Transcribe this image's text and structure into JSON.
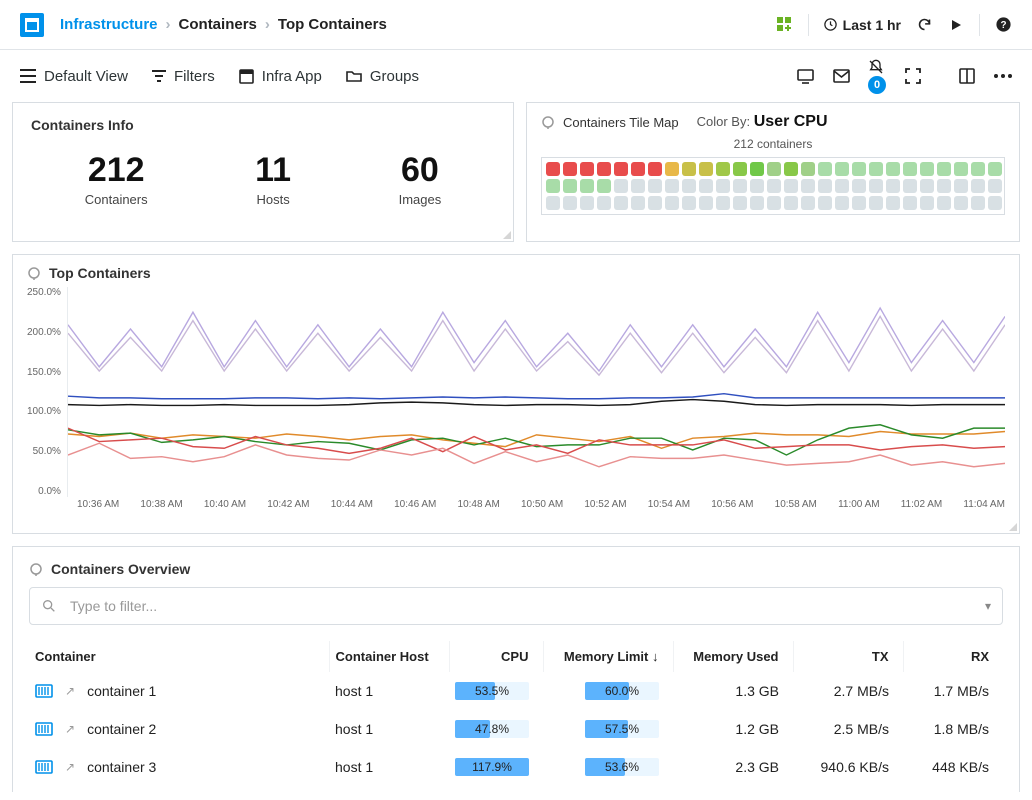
{
  "breadcrumbs": {
    "root": "Infrastructure",
    "mid": "Containers",
    "leaf": "Top Containers"
  },
  "topbar": {
    "timerange": "Last 1 hr"
  },
  "toolbar": {
    "default_view": "Default View",
    "filters": "Filters",
    "infra_app": "Infra App",
    "groups": "Groups",
    "badge": "0"
  },
  "info": {
    "title": "Containers Info",
    "containers_n": "212",
    "containers_l": "Containers",
    "hosts_n": "11",
    "hosts_l": "Hosts",
    "images_n": "60",
    "images_l": "Images"
  },
  "tilemap": {
    "title": "Containers Tile Map",
    "colorby_label": "Color By:",
    "colorby_value": "User CPU",
    "subtitle": "212 containers"
  },
  "chart_panel_title": "Top Containers",
  "chart_data": {
    "type": "line",
    "ylabel_unit": "%",
    "ylim": [
      0,
      250
    ],
    "y_ticks": [
      "250.0%",
      "200.0%",
      "150.0%",
      "100.0%",
      "50.0%",
      "0.0%"
    ],
    "x_ticks": [
      "10:36 AM",
      "10:38 AM",
      "10:40 AM",
      "10:42 AM",
      "10:44 AM",
      "10:46 AM",
      "10:48 AM",
      "10:50 AM",
      "10:52 AM",
      "10:54 AM",
      "10:56 AM",
      "10:58 AM",
      "11:00 AM",
      "11:02 AM",
      "11:04 AM"
    ],
    "series": [
      {
        "name": "series-a",
        "color": "#b8a8e0",
        "values": [
          205,
          155,
          200,
          155,
          220,
          155,
          210,
          155,
          205,
          155,
          200,
          155,
          220,
          160,
          210,
          155,
          195,
          150,
          205,
          155,
          205,
          155,
          200,
          155,
          220,
          160,
          225,
          160,
          210,
          160,
          215
        ]
      },
      {
        "name": "series-b",
        "color": "#c8b8d8",
        "values": [
          195,
          150,
          190,
          150,
          210,
          150,
          200,
          150,
          195,
          150,
          190,
          150,
          210,
          150,
          200,
          150,
          185,
          145,
          195,
          148,
          195,
          148,
          190,
          148,
          210,
          150,
          215,
          150,
          200,
          150,
          205
        ]
      },
      {
        "name": "series-c",
        "color": "#2f4fbf",
        "values": [
          120,
          118,
          118,
          117,
          117,
          117,
          118,
          118,
          117,
          118,
          117,
          118,
          119,
          118,
          119,
          118,
          117,
          117,
          118,
          118,
          119,
          123,
          118,
          118,
          118,
          118,
          118,
          118,
          118,
          118,
          118
        ]
      },
      {
        "name": "series-d",
        "color": "#1a1a1a",
        "values": [
          110,
          109,
          110,
          109,
          109,
          110,
          109,
          109,
          109,
          110,
          112,
          113,
          112,
          110,
          109,
          110,
          110,
          109,
          110,
          114,
          116,
          114,
          110,
          109,
          110,
          110,
          110,
          109,
          110,
          110,
          110
        ]
      },
      {
        "name": "series-e",
        "color": "#e08a2a",
        "values": [
          75,
          72,
          76,
          70,
          74,
          72,
          70,
          75,
          72,
          68,
          72,
          74,
          68,
          64,
          60,
          74,
          70,
          66,
          72,
          58,
          70,
          72,
          76,
          74,
          74,
          72,
          78,
          75,
          75,
          75,
          78
        ]
      },
      {
        "name": "series-f",
        "color": "#2a8a2a",
        "values": [
          80,
          74,
          76,
          65,
          68,
          72,
          66,
          62,
          66,
          64,
          56,
          68,
          70,
          62,
          70,
          60,
          62,
          62,
          70,
          70,
          56,
          70,
          68,
          50,
          68,
          82,
          86,
          74,
          70,
          82,
          82
        ]
      },
      {
        "name": "series-g",
        "color": "#d84c4c",
        "values": [
          82,
          66,
          68,
          70,
          60,
          58,
          72,
          62,
          58,
          52,
          58,
          70,
          54,
          72,
          56,
          62,
          52,
          68,
          62,
          62,
          62,
          68,
          58,
          60,
          62,
          62,
          56,
          60,
          62,
          58,
          60
        ]
      },
      {
        "name": "series-h",
        "color": "#e89090",
        "values": [
          50,
          64,
          46,
          48,
          42,
          48,
          62,
          50,
          46,
          44,
          56,
          50,
          58,
          40,
          54,
          42,
          50,
          36,
          48,
          46,
          46,
          50,
          44,
          38,
          40,
          42,
          50,
          38,
          42,
          36,
          40
        ]
      }
    ]
  },
  "overview": {
    "title": "Containers Overview",
    "filter_placeholder": "Type to filter...",
    "cols": {
      "container": "Container",
      "host": "Container Host",
      "cpu": "CPU",
      "memlimit": "Memory Limit",
      "memused": "Memory Used",
      "tx": "TX",
      "rx": "RX"
    },
    "rows": [
      {
        "name": "container 1",
        "host": "host 1",
        "cpu": "53.5%",
        "cpu_pct": 53.5,
        "memlimit": "60.0%",
        "memlimit_pct": 60.0,
        "memused": "1.3 GB",
        "tx": "2.7 MB/s",
        "rx": "1.7 MB/s"
      },
      {
        "name": "container 2",
        "host": "host 1",
        "cpu": "47.8%",
        "cpu_pct": 47.8,
        "memlimit": "57.5%",
        "memlimit_pct": 57.5,
        "memused": "1.2 GB",
        "tx": "2.5 MB/s",
        "rx": "1.8 MB/s"
      },
      {
        "name": "container 3",
        "host": "host 1",
        "cpu": "117.9%",
        "cpu_pct": 100,
        "memlimit": "53.6%",
        "memlimit_pct": 53.6,
        "memused": "2.3 GB",
        "tx": "940.6 KB/s",
        "rx": "448 KB/s"
      }
    ]
  }
}
